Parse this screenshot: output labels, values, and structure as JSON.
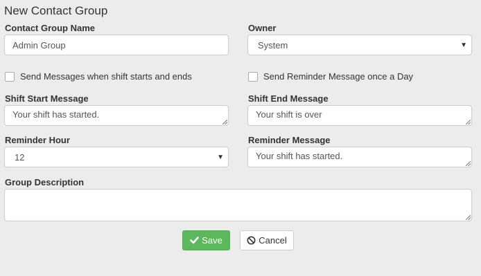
{
  "form": {
    "title": "New Contact Group"
  },
  "fields": {
    "group_name": {
      "label": "Contact Group Name",
      "value": "Admin Group"
    },
    "owner": {
      "label": "Owner",
      "value": "System"
    },
    "send_messages_shift": {
      "label": "Send Messages when shift starts and ends",
      "checked": false
    },
    "send_reminder_daily": {
      "label": "Send Reminder Message once a Day",
      "checked": false
    },
    "shift_start_message": {
      "label": "Shift Start Message",
      "value": "Your shift has started."
    },
    "shift_end_message": {
      "label": "Shift End Message",
      "value": "Your shift is over"
    },
    "reminder_hour": {
      "label": "Reminder Hour",
      "value": "12"
    },
    "reminder_message": {
      "label": "Reminder Message",
      "value": "Your shift has started."
    },
    "group_description": {
      "label": "Group Description",
      "value": ""
    }
  },
  "buttons": {
    "save_label": "Save",
    "cancel_label": "Cancel"
  },
  "icons": {
    "save": "check-icon",
    "cancel": "ban-icon",
    "dropdown": "caret-down-icon"
  },
  "colors": {
    "background": "#ececec",
    "save_button": "#5cb85c",
    "text": "#333333",
    "border": "#cccccc"
  }
}
